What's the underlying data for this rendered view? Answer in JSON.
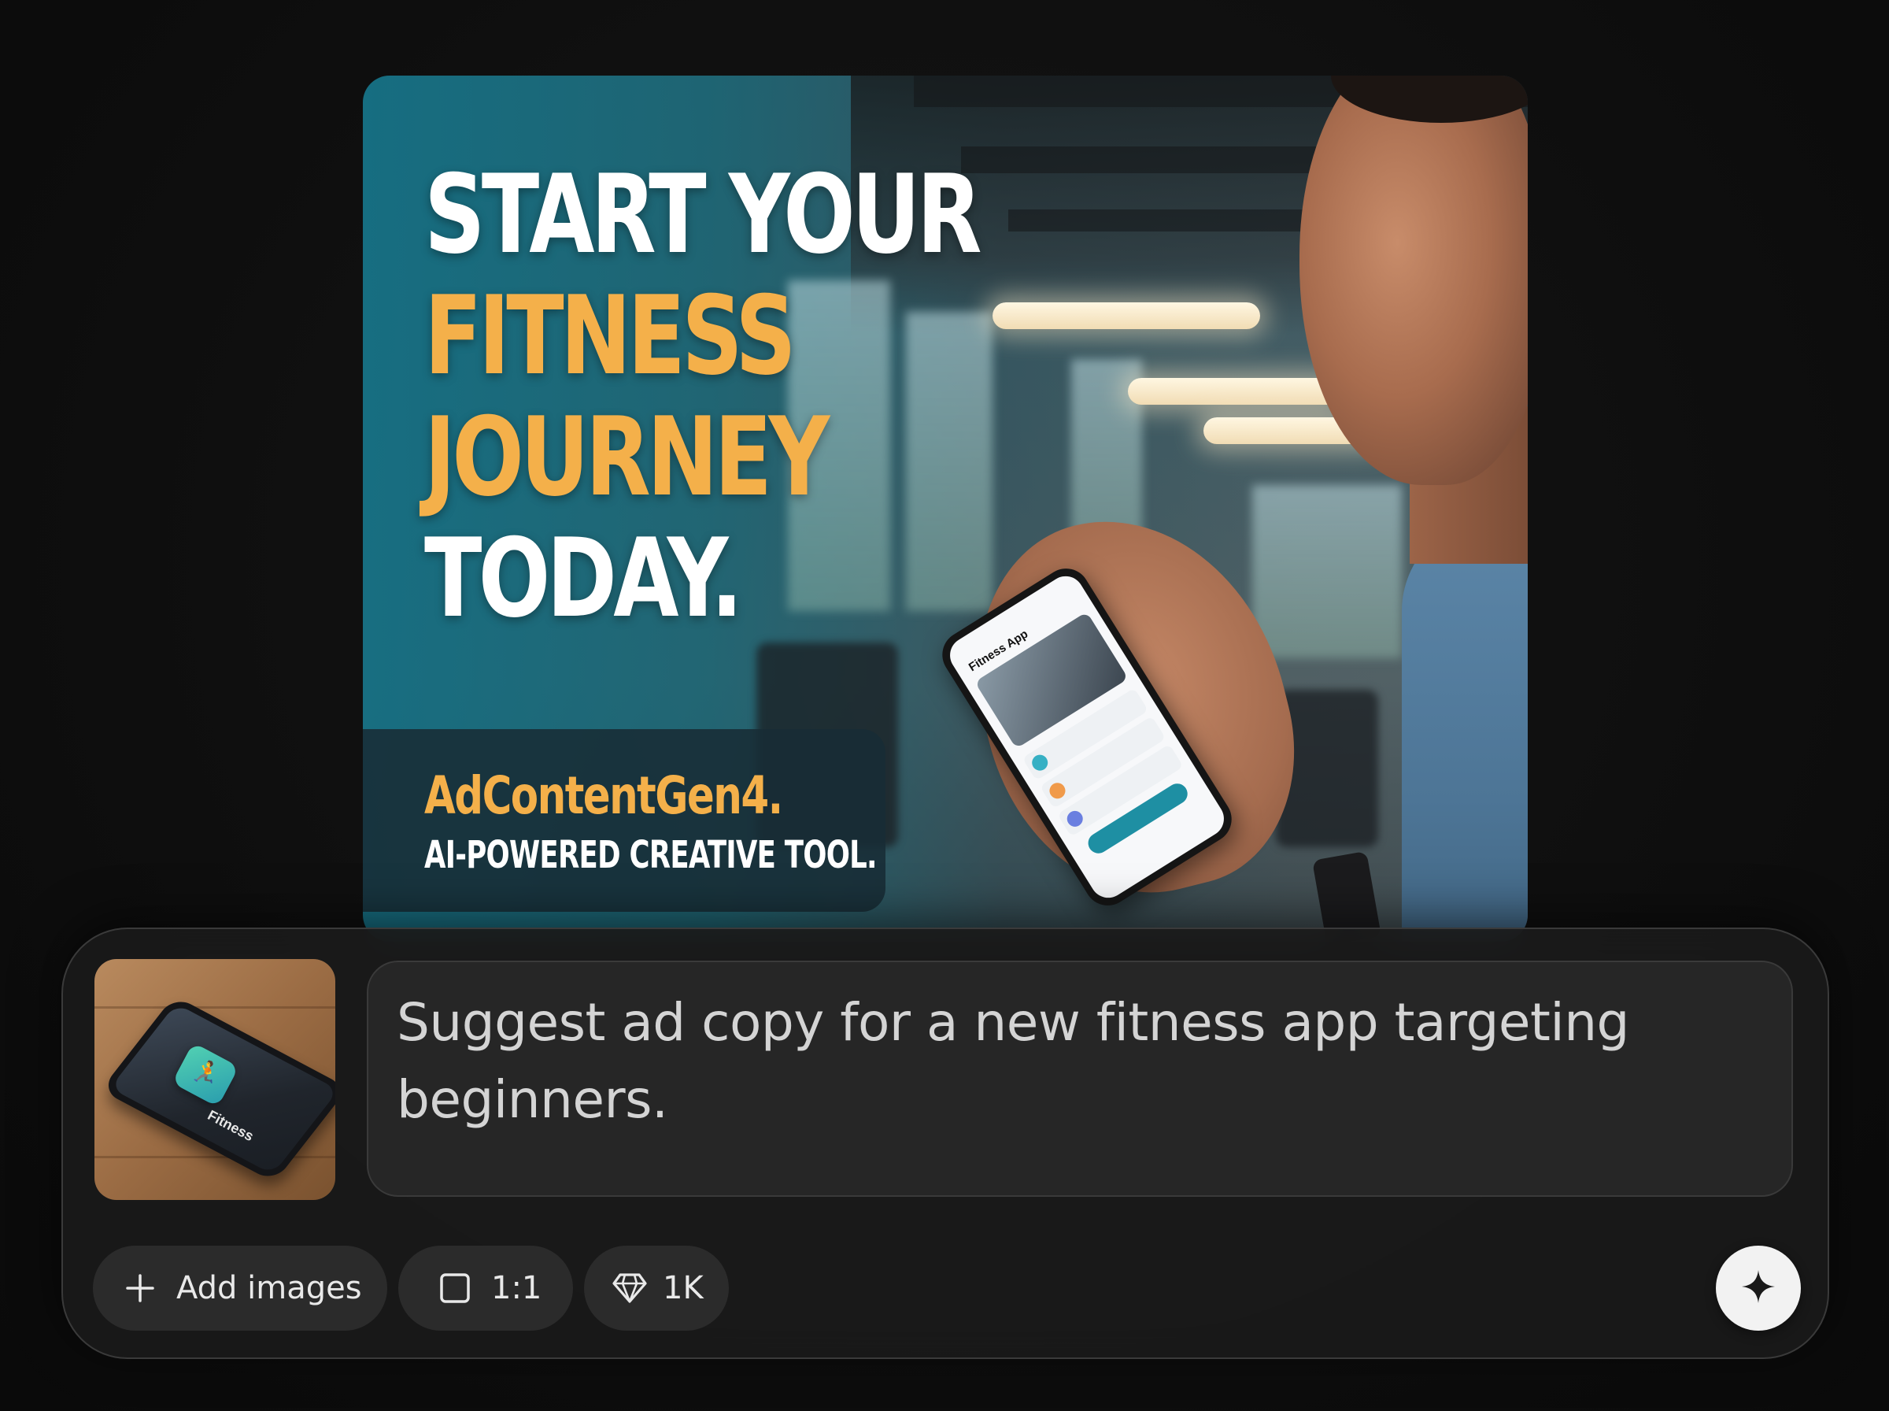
{
  "generated_ad": {
    "headline_line1": "START YOUR",
    "headline_line2": "FITNESS",
    "headline_line3": "JOURNEY",
    "headline_line4": "TODAY.",
    "brand": "AdContentGen4.",
    "tagline": "AI-POWERED CREATIVE TOOL.",
    "phone_screen_title": "Fitness App",
    "accent_color": "#f4b04a"
  },
  "composer": {
    "attachment": {
      "alt": "Phone with Fitness app on wooden desk",
      "app_label": "Fitness"
    },
    "prompt_text": "Suggest ad copy for a new fitness app targeting beginners.",
    "add_images_label": "Add images",
    "aspect_ratio_label": "1:1",
    "quality_label": "1K",
    "icons": {
      "add": "plus-icon",
      "ratio": "square-icon",
      "quality": "diamond-icon",
      "send": "sparkle-icon"
    }
  }
}
